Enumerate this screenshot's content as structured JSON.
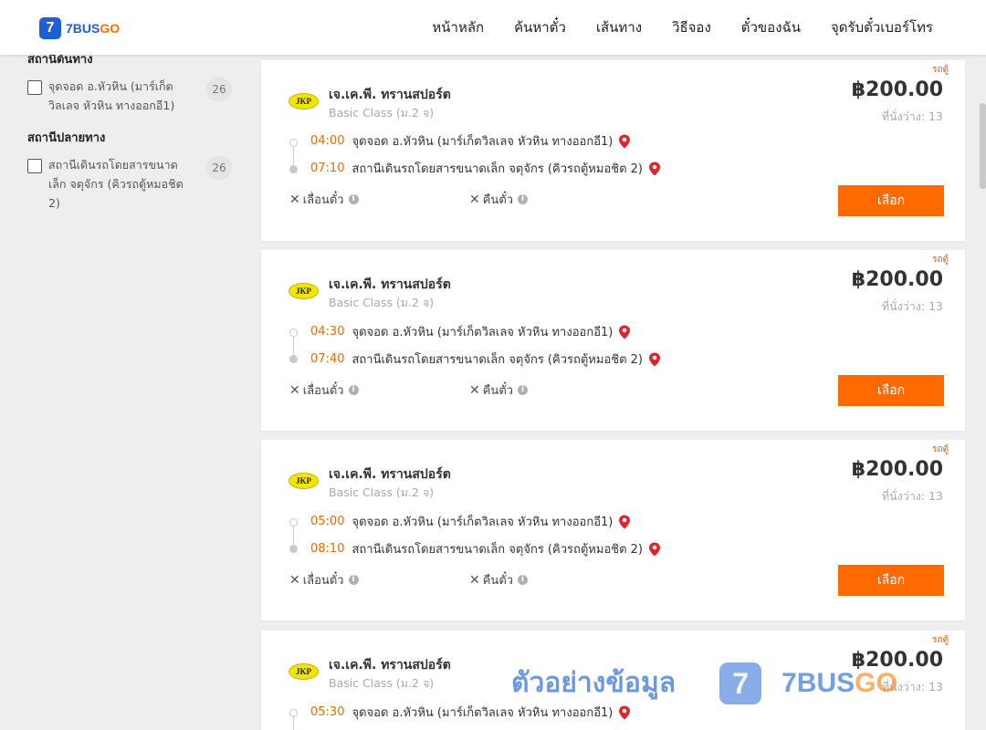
{
  "header": {
    "logo_mark": "7",
    "logo_blue": "7BUS",
    "logo_orange": "GO",
    "nav": [
      "หน้าหลัก",
      "ค้นหาตั๋ว",
      "เส้นทาง",
      "วิธีจอง",
      "ตั๋วของฉัน",
      "จุดรับตั๋วเบอร์โทร"
    ]
  },
  "sidebar": {
    "origin_title": "สถานีต้นทาง",
    "origin_option": "จุดจอด อ.หัวหิน (มาร์เก็ตวิลเลจ หัวหิน ทางออกอี1)",
    "origin_count": "26",
    "dest_title": "สถานีปลายทาง",
    "dest_option": "สถานีเดินรถโดยสารขนาดเล็ก จตุจักร (คิวรถตู้หมอชิต 2)",
    "dest_count": "26"
  },
  "trips": [
    {
      "tag": "รถตู้",
      "logo": "JKP",
      "operator": "เจ.เค.พี. ทรานสปอร์ต",
      "class": "Basic Class (ม.2 จ)",
      "price": "฿200.00",
      "seats": "ที่นั่งว่าง: 13",
      "dep_time": "04:00",
      "dep_stop": "จุดจอด อ.หัวหิน (มาร์เก็ตวิลเลจ หัวหิน ทางออกอี1)",
      "arr_time": "07:10",
      "arr_stop": "สถานีเดินรถโดยสารขนาดเล็ก จตุจักร (คิวรถตู้หมอชิต 2)",
      "reschedule": "เลื่อนตั๋ว",
      "refund": "คืนตั๋ว",
      "button": "เลือก"
    },
    {
      "tag": "รถตู้",
      "logo": "JKP",
      "operator": "เจ.เค.พี. ทรานสปอร์ต",
      "class": "Basic Class (ม.2 จ)",
      "price": "฿200.00",
      "seats": "ที่นั่งว่าง: 13",
      "dep_time": "04:30",
      "dep_stop": "จุดจอด อ.หัวหิน (มาร์เก็ตวิลเลจ หัวหิน ทางออกอี1)",
      "arr_time": "07:40",
      "arr_stop": "สถานีเดินรถโดยสารขนาดเล็ก จตุจักร (คิวรถตู้หมอชิต 2)",
      "reschedule": "เลื่อนตั๋ว",
      "refund": "คืนตั๋ว",
      "button": "เลือก"
    },
    {
      "tag": "รถตู้",
      "logo": "JKP",
      "operator": "เจ.เค.พี. ทรานสปอร์ต",
      "class": "Basic Class (ม.2 จ)",
      "price": "฿200.00",
      "seats": "ที่นั่งว่าง: 13",
      "dep_time": "05:00",
      "dep_stop": "จุดจอด อ.หัวหิน (มาร์เก็ตวิลเลจ หัวหิน ทางออกอี1)",
      "arr_time": "08:10",
      "arr_stop": "สถานีเดินรถโดยสารขนาดเล็ก จตุจักร (คิวรถตู้หมอชิต 2)",
      "reschedule": "เลื่อนตั๋ว",
      "refund": "คืนตั๋ว",
      "button": "เลือก"
    },
    {
      "tag": "รถตู้",
      "logo": "JKP",
      "operator": "เจ.เค.พี. ทรานสปอร์ต",
      "class": "Basic Class (ม.2 จ)",
      "price": "฿200.00",
      "seats": "ที่นั่งว่าง: 13",
      "dep_time": "05:30",
      "dep_stop": "จุดจอด อ.หัวหิน (มาร์เก็ตวิลเลจ หัวหิน ทางออกอี1)",
      "arr_time": "",
      "arr_stop": "",
      "reschedule": "",
      "refund": "",
      "button": ""
    }
  ],
  "watermark": {
    "text": "ตัวอย่างข้อมูล",
    "mark": "7",
    "brand_blue": "7BUS",
    "brand_orange": "GO"
  },
  "colors": {
    "accent": "#ff6a00",
    "brand_blue": "#1f5fd6",
    "time": "#e86c00",
    "pin": "#e0242c"
  }
}
